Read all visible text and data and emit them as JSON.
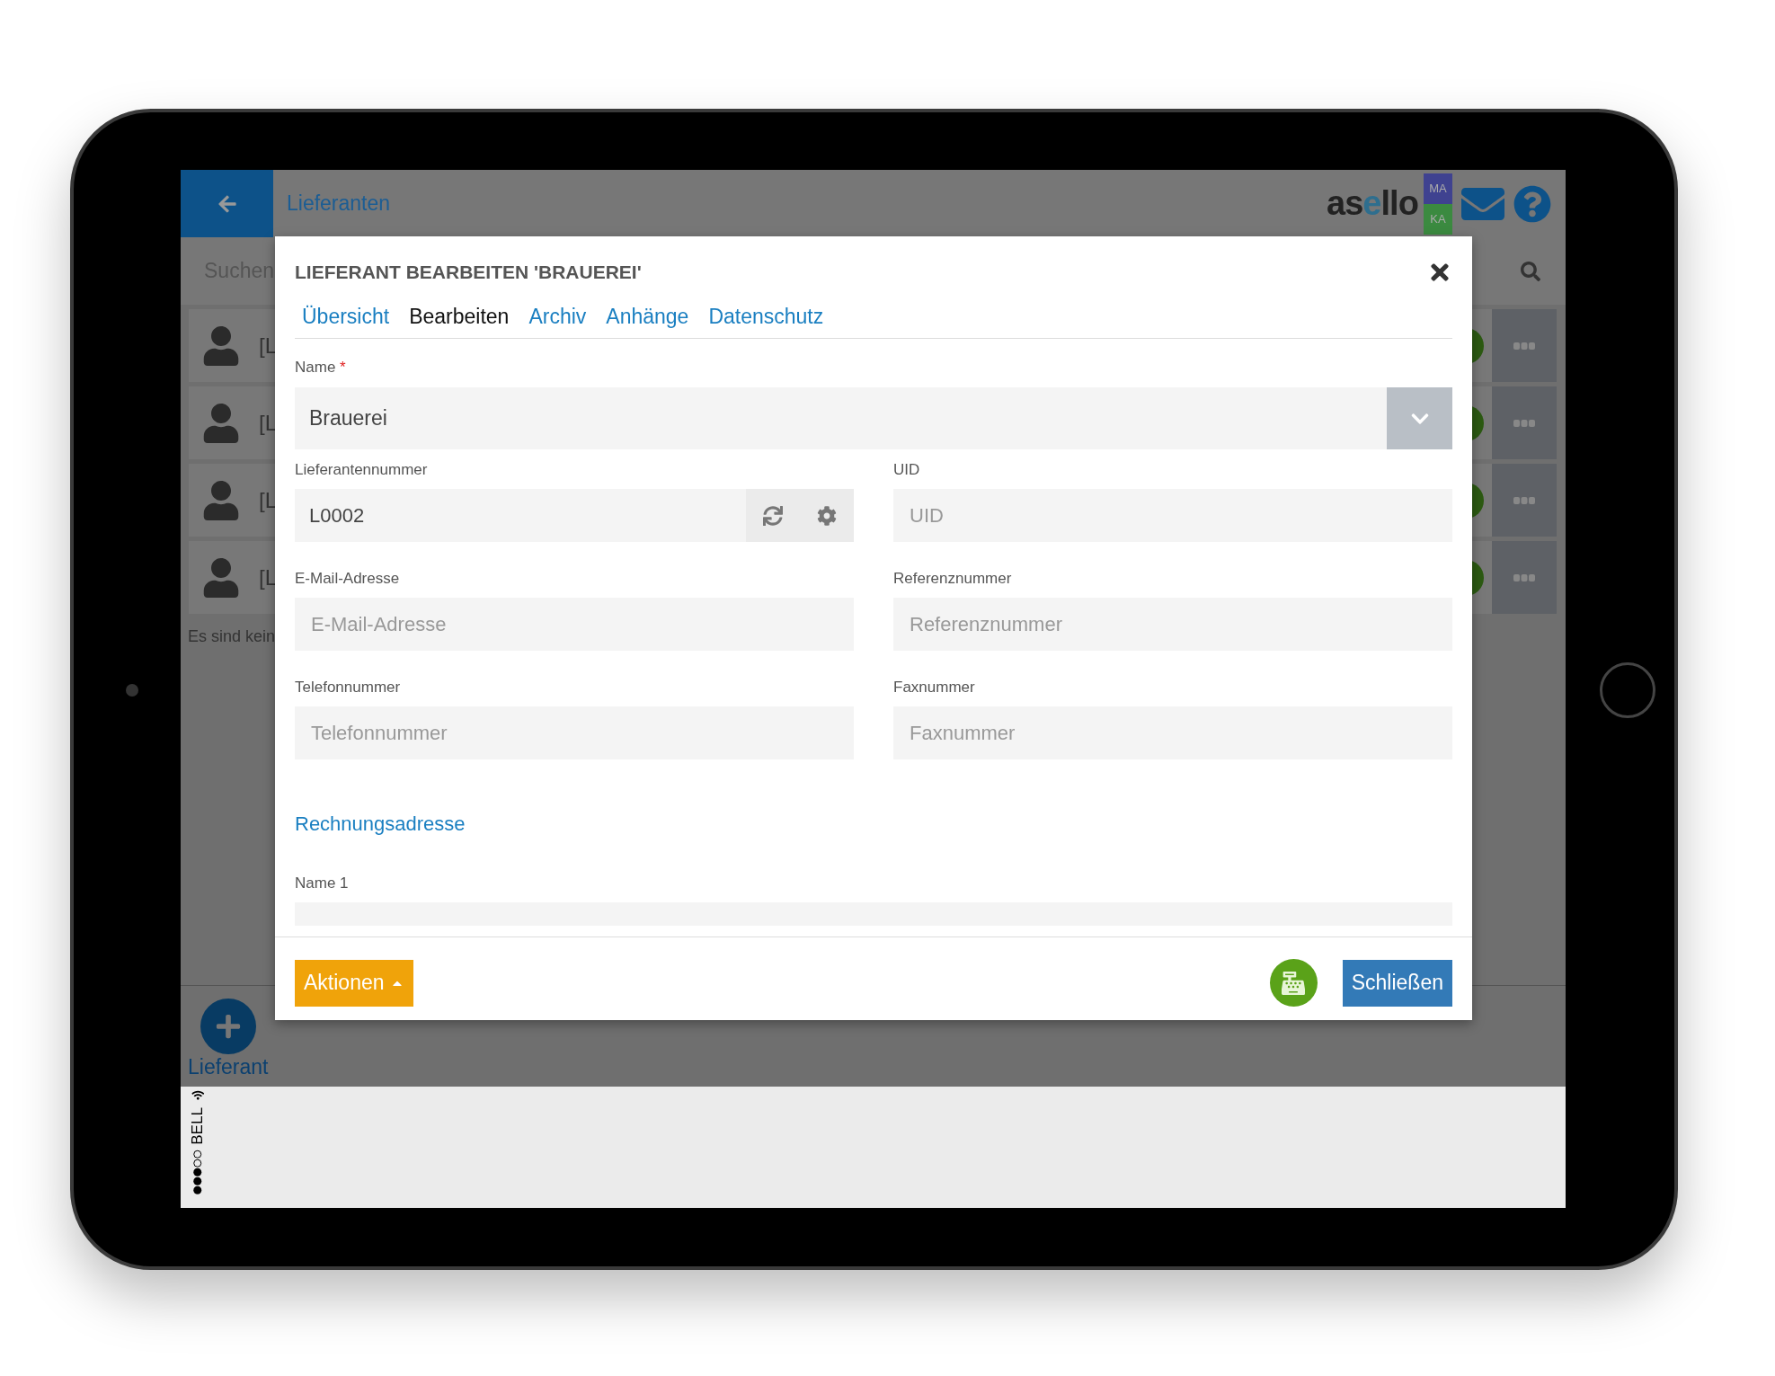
{
  "header": {
    "title": "Lieferanten",
    "logo": "asello",
    "badges": [
      {
        "label": "MA",
        "color": "#3f4290"
      },
      {
        "label": "KA",
        "color": "#3b8a40"
      }
    ]
  },
  "search": {
    "placeholder": "Suchen"
  },
  "list": {
    "rows": [
      {
        "label": "[L"
      },
      {
        "label": "[L"
      },
      {
        "label": "[L"
      },
      {
        "label": "[L"
      }
    ],
    "empty_message": "Es sind kein"
  },
  "add_button": {
    "label": "Lieferant"
  },
  "status_bar": {
    "carrier": "BELL"
  },
  "dialog": {
    "title": "LIEFERANT BEARBEITEN 'BRAUEREI'",
    "tabs": [
      {
        "label": "Übersicht",
        "selected": false
      },
      {
        "label": "Bearbeiten",
        "selected": true
      },
      {
        "label": "Archiv",
        "selected": false
      },
      {
        "label": "Anhänge",
        "selected": false
      },
      {
        "label": "Datenschutz",
        "selected": false
      }
    ],
    "name_field": {
      "label": "Name",
      "required": true,
      "value": "Brauerei"
    },
    "fields": [
      {
        "kind": "generator",
        "label": "Lieferantennummer",
        "required": false,
        "value": "L0002"
      },
      {
        "kind": "text",
        "label": "UID",
        "required": false,
        "placeholder": "UID"
      },
      {
        "kind": "text",
        "label": "E-Mail-Adresse",
        "required": false,
        "placeholder": "E-Mail-Adresse"
      },
      {
        "kind": "text",
        "label": "Referenznummer",
        "required": false,
        "placeholder": "Referenznummer"
      },
      {
        "kind": "text",
        "label": "Telefonnummer",
        "required": false,
        "placeholder": "Telefonnummer"
      },
      {
        "kind": "text",
        "label": "Faxnummer",
        "required": false,
        "placeholder": "Faxnummer"
      }
    ],
    "required_mark": "*",
    "section": "Rechnungsadresse",
    "partial_field": {
      "label": "Name 1"
    },
    "actions_button": "Aktionen",
    "close_button": "Schließen"
  }
}
